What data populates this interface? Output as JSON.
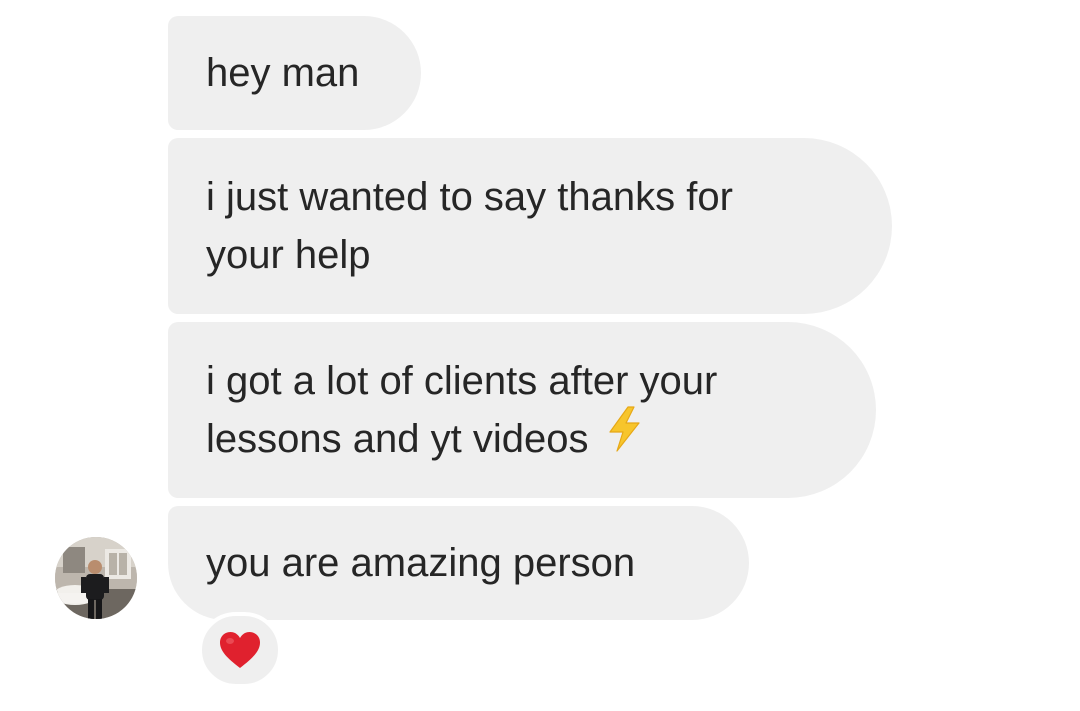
{
  "messages": [
    {
      "lines": [
        "hey man"
      ]
    },
    {
      "lines": [
        "i just wanted to say thanks for",
        "your help"
      ]
    },
    {
      "lines": [
        "i got a lot of clients after your",
        "lessons and yt videos"
      ],
      "emoji": "lightning-bolt-icon"
    },
    {
      "lines": [
        "you are amazing person"
      ]
    }
  ],
  "reaction": {
    "emoji": "red-heart-icon",
    "color": "#e0212e"
  },
  "colors": {
    "bubble_bg": "#efefef",
    "text": "#262626",
    "lightning": "#f7c52c"
  }
}
